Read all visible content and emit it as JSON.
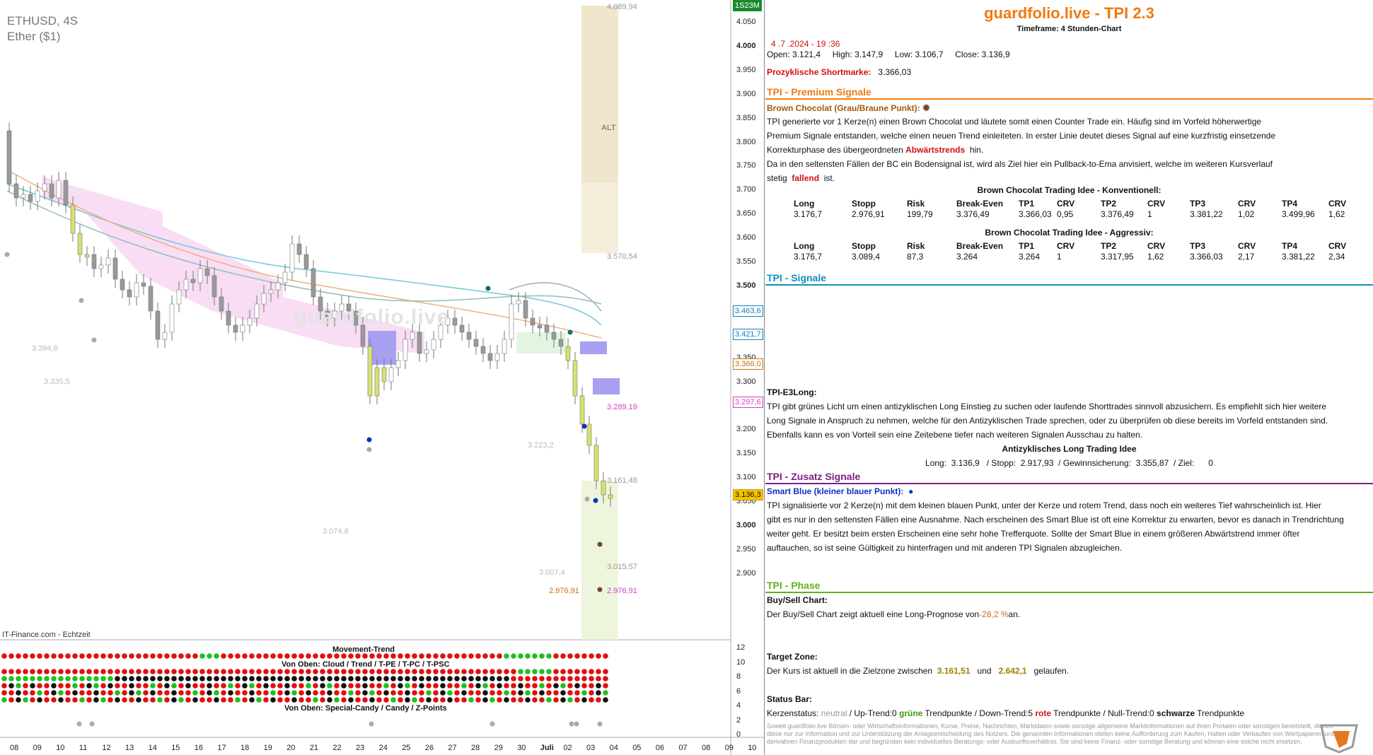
{
  "chart": {
    "symbol": "ETHUSD, 4S",
    "name": "Ether ($1)",
    "watermark": "guardfolio.live",
    "source": "IT-Finance.com - Echtzeit",
    "zone_label": "ALT",
    "price_labels": [
      "4.089,94",
      "3.570,54",
      "3.394,8",
      "3.335,5",
      "3.289,19",
      "3.223,2",
      "3.161,48",
      "3.074,8",
      "3.015,57",
      "3.007,4",
      "2.976,91",
      "2.976,91"
    ],
    "y_axis": [
      "4.050",
      "4.000",
      "3.950",
      "3.900",
      "3.850",
      "3.800",
      "3.750",
      "3.700",
      "3.650",
      "3.600",
      "3.550",
      "3.500",
      "3.450",
      "3.400",
      "3.350",
      "3.300",
      "3.250",
      "3.200",
      "3.150",
      "3.100",
      "3.050",
      "3.000",
      "2.950",
      "2.900"
    ],
    "axis_boxes": [
      "1S23M",
      "3.463,6",
      "3.421,7",
      "3.366,0",
      "3.297,6",
      "3.136,3"
    ],
    "x_axis": [
      "08",
      "09",
      "10",
      "11",
      "12",
      "13",
      "14",
      "15",
      "16",
      "17",
      "18",
      "19",
      "20",
      "21",
      "22",
      "23",
      "24",
      "25",
      "26",
      "27",
      "28",
      "29",
      "30",
      "Juli",
      "02",
      "03",
      "04",
      "05",
      "06",
      "07",
      "08",
      "09",
      "10"
    ],
    "movement_trend_title": "Movement-Trend",
    "cloud_title": "Von Oben: Cloud / Trend / T-PE / T-PC / T-PSC",
    "special_title": "Von Oben: Special-Candy / Candy / Z-Points",
    "lower_axis": [
      "12",
      "10",
      "8",
      "6",
      "4",
      "2",
      "0"
    ]
  },
  "info": {
    "title": "guardfolio.live - TPI 2.3",
    "timeframe": "Timeframe: 4 Stunden-Chart",
    "datetime": "4 .7 .2024 - 19 :36",
    "ohlc": {
      "open_label": "Open:",
      "open": "3.121,4",
      "high_label": "High:",
      "high": "3.147,9",
      "low_label": "Low:",
      "low": "3.106,7",
      "close_label": "Close:",
      "close": "3.136,9"
    },
    "short_label": "Prozyklische Shortmarke:",
    "short_value": "3.366,03",
    "sec_premium": "TPI - Premium Signale",
    "bc_title": "Brown Chocolat (Grau/Braune Punkt):",
    "bc_text1": "TPI generierte vor 1  Kerze(n) einen Brown Chocolat und läutete somit einen Counter Trade ein. Häufig sind im Vorfeld höherwertige",
    "bc_text2": "Premium Signale entstanden, welche einen neuen Trend einleiteten. In erster Linie deutet dieses Signal auf eine kurzfristig einsetzende",
    "bc_text3a": "Korrekturphase des übergeordneten",
    "bc_text3b": "Abwärtstrends",
    "bc_text3c": "hin.",
    "bc_text4": "Da in den seltensten Fällen der BC ein Bodensignal ist, wird als Ziel hier ein Pullback-to-Ema anvisiert, welche im weiteren Kursverlauf",
    "bc_text5a": "stetig",
    "bc_text5b": "fallend",
    "bc_text5c": "ist.",
    "table1_title": "Brown Chocolat Trading Idee - Konventionell:",
    "table2_title": "Brown Chocolat Trading Idee - Aggressiv:",
    "table_headers": [
      "Long",
      "Stopp",
      "Risk",
      "Break-Even",
      "TP1",
      "CRV",
      "TP2",
      "CRV",
      "TP3",
      "CRV",
      "TP4",
      "CRV"
    ],
    "table1_values": [
      "3.176,7",
      "2.976,91",
      "199,79",
      "3.376,49",
      "3.366,03",
      "0,95",
      "3.376,49",
      "1",
      "3.381,22",
      "1,02",
      "3.499,96",
      "1,62"
    ],
    "table2_values": [
      "3.176,7",
      "3.089,4",
      "87,3",
      "3.264",
      "3.264",
      "1",
      "3.317,95",
      "1,62",
      "3.366,03",
      "2,17",
      "3.381,22",
      "2,34"
    ],
    "sec_signale": "TPI - Signale",
    "e3_title": "TPI-E3Long:",
    "e3_text1": "TPI gibt grünes Licht um einen antizyklischen Long Einstieg zu suchen oder laufende Shorttrades sinnvoll abzusichern. Es empfiehlt sich hier weitere",
    "e3_text2": "Long Signale in Anspruch zu nehmen, welche für den Antizyklischen Trade sprechen, oder zu überprüfen ob diese bereits im Vorfeld entstanden sind.",
    "e3_text3": "Ebenfalls kann es von Vorteil sein eine Zeitebene tiefer nach weiteren Signalen Ausschau zu halten.",
    "e3_idea_title": "Antizyklisches Long Trading Idee",
    "e3_idea": "Long:  3.136,9   / Stopp:  2.917,93  / Gewinnsicherung:  3.355,87  / Ziel:      0",
    "sec_zusatz": "TPI - Zusatz Signale",
    "sb_title": "Smart Blue (kleiner blauer Punkt):",
    "sb_text1": "TPI signalisierte vor 2  Kerze(n) mit dem kleinen blauen Punkt, unter der Kerze und rotem Trend, dass noch ein weiteres Tief wahrscheinlich ist. Hier",
    "sb_text2": "gibt es nur in den seltensten Fällen eine Ausnahme. Nach erscheinen des Smart Blue ist oft eine Korrektur zu erwarten, bevor es danach in Trendrichtung",
    "sb_text3": "weiter geht. Er besitzt beim ersten Erscheinen eine sehr hohe Trefferquote. Sollte der Smart Blue in einem größeren Abwärtstrend immer öfter",
    "sb_text4": "auftauchen, so ist seine Gültigkeit zu hinterfragen und mit anderen TPI Signalen abzugleichen.",
    "sec_phase": "TPI - Phase",
    "bs_title": "Buy/Sell Chart:",
    "bs_text_a": "Der Buy/Sell Chart zeigt aktuell eine Long-Prognose von",
    "bs_value": "-28,2 %",
    "bs_text_b": "an.",
    "tz_title": "Target Zone:",
    "tz_text_a": "Der Kurs ist aktuell in die Zielzone zwischen",
    "tz_v1": "3.161,51",
    "tz_and": "und",
    "tz_v2": "2.642,1",
    "tz_text_b": "gelaufen.",
    "status_title": "Status Bar:",
    "status_a": "Kerzenstatus:",
    "status_neutral": "neutral",
    "status_b": " / Up-Trend:0",
    "status_green": "grüne",
    "status_c": "Trendpunkte  / Down-Trend:5",
    "status_red": "rote",
    "status_d": "Trendpunkte  / Null-Trend:0",
    "status_black": "schwarze",
    "status_e": "Trendpunkte",
    "disclaimer": "Soweit guardfolio.live Börsen- oder Wirtschaftsinformationen, Kurse, Preise, Nachrichten, Marktdaten sowie sonstige allgemeine Marktinformationen auf ihren Portalen oder sonstigen bereitstellt, dienen diese nur zur Information und zur Unterstützung der Anlageentscheidung des Nutzers. Die genannten Informationen stellen keine Aufforderung zum Kaufen, Halten oder Verkaufen von Wertpapieren und derivativen Finanzprodukten dar und begründen kein individuelles Beratungs- oder Auskunftsverhältnis. Sie sind keine Finanz- oder sonstige Beratung und können eine solche nicht ersetzen."
  },
  "colors": {
    "accent": "#f07a10",
    "premium_line": "#f07a10",
    "signale_line": "#1090c0",
    "zusatz_line": "#802080",
    "phase_line": "#60b020"
  }
}
